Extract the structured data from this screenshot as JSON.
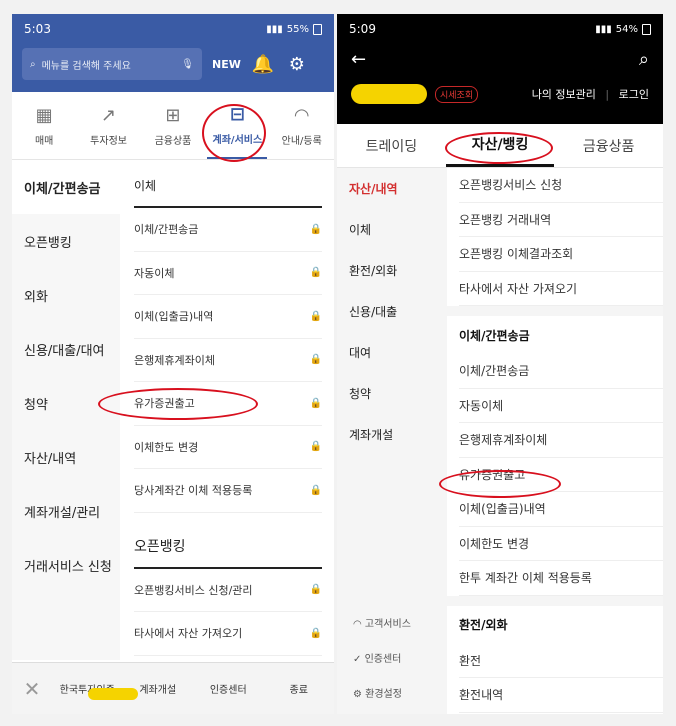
{
  "left": {
    "status": {
      "time": "5:03",
      "icons": "▣",
      "right": "55%"
    },
    "search": {
      "placeholder": "메뉴를 검색해 주세요",
      "new_label": "NEW"
    },
    "categories": [
      {
        "label": "매매",
        "icon": "chart-doc-icon"
      },
      {
        "label": "투자정보",
        "icon": "trend-icon"
      },
      {
        "label": "금융상품",
        "icon": "gift-icon"
      },
      {
        "label": "계좌/서비스",
        "icon": "account-icon"
      },
      {
        "label": "안내/등록",
        "icon": "headset-icon"
      }
    ],
    "sidebar": [
      "이체/간편송금",
      "오픈뱅킹",
      "외화",
      "신용/대출/대여",
      "청약",
      "자산/내역",
      "계좌개설/관리",
      "거래서비스 신청"
    ],
    "sections": [
      {
        "title": "이체",
        "items": [
          "이체/간편송금",
          "자동이체",
          "이체(입출금)내역",
          "은행제휴계좌이체",
          "유가증권출고",
          "이체한도 변경",
          "당사계좌간 이체 적용등록"
        ]
      },
      {
        "title": "오픈뱅킹",
        "items": [
          "오픈뱅킹서비스 신청/관리",
          "타사에서 자산 가져오기"
        ]
      }
    ],
    "footer": [
      "한국투자인증",
      "계좌개설",
      "인증센터",
      "종료"
    ]
  },
  "right": {
    "status": {
      "time": "5:09",
      "right": "54%"
    },
    "account": {
      "badge": "시세조회",
      "my_info": "나의 정보관리",
      "login": "로그인"
    },
    "tabs": [
      "트레이딩",
      "자산/뱅킹",
      "금융상품"
    ],
    "sidebar": [
      "자산/내역",
      "이체",
      "환전/외화",
      "신용/대출",
      "대여",
      "청약",
      "계좌개설"
    ],
    "footer": [
      "고객서비스",
      "인증센터",
      "환경설정"
    ],
    "groups": [
      {
        "title": "",
        "items": [
          "오픈뱅킹서비스 신청",
          "오픈뱅킹 거래내역",
          "오픈뱅킹 이체결과조회",
          "타사에서 자산 가져오기"
        ]
      },
      {
        "title": "이체/간편송금",
        "items": [
          "이체/간편송금",
          "자동이체",
          "은행제휴계좌이체",
          "유가증권출고",
          "이체(입출금)내역",
          "이체한도 변경",
          "한투 계좌간 이체 적용등록"
        ]
      },
      {
        "title": "환전/외화",
        "items": [
          "환전",
          "환전내역"
        ]
      }
    ]
  },
  "colors": {
    "left_header": "#3a5ba5",
    "right_header": "#000000",
    "highlight": "#d8101e"
  }
}
